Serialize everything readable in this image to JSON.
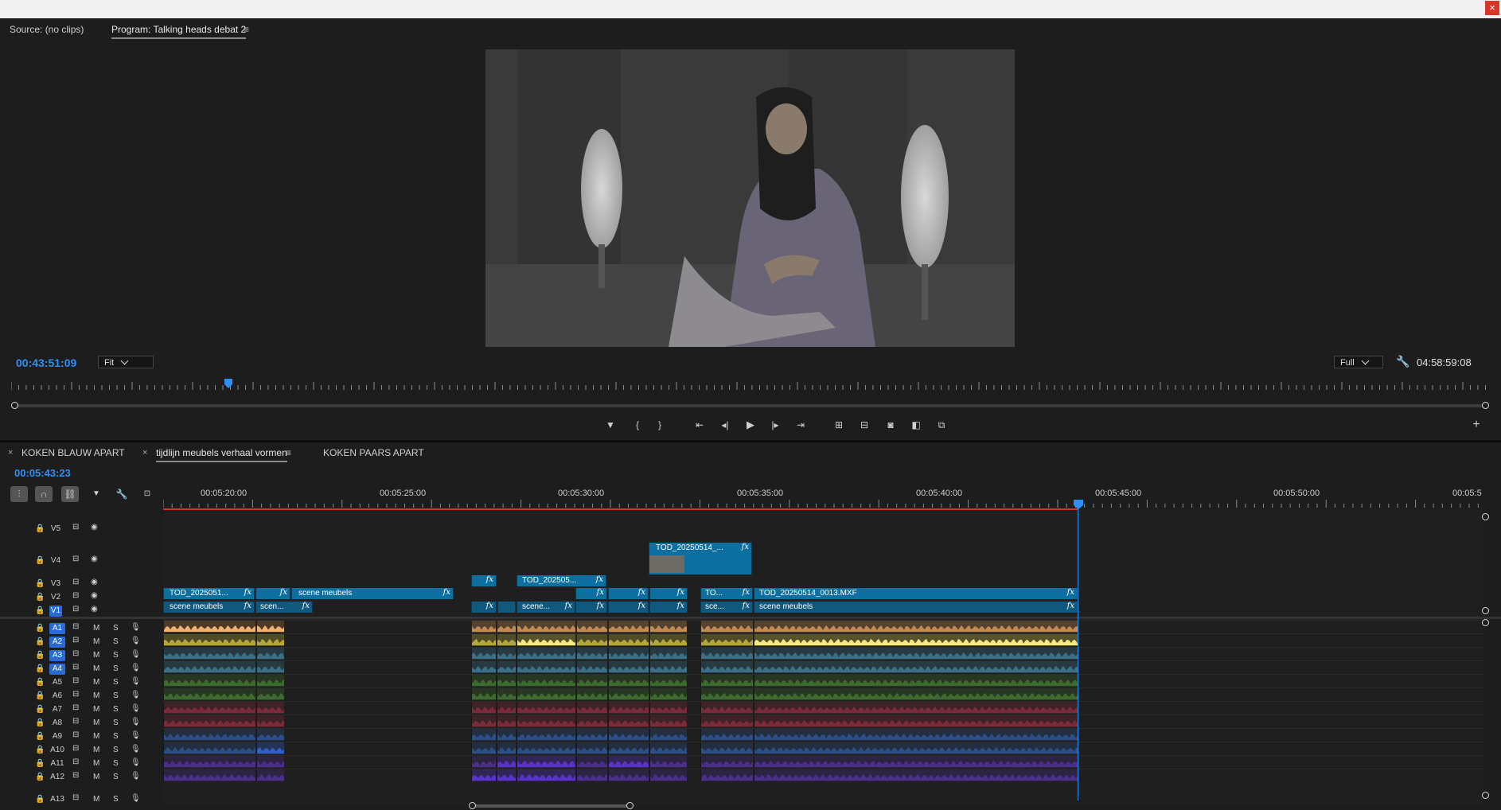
{
  "source_panel": {
    "source_tab": "Source: (no clips)",
    "program_tab": "Program: Talking heads debat 2",
    "menu_glyph": "≡"
  },
  "program_monitor": {
    "current_timecode": "00:43:51:09",
    "zoom_select": "Fit",
    "resolution_select": "Full",
    "duration_timecode": "04:58:59:08",
    "playhead_fraction": 0.147
  },
  "transport_icons": [
    "add-marker-icon",
    "mark-in-icon",
    "mark-out-icon",
    "go-to-in-icon",
    "step-back-icon",
    "play-icon",
    "step-forward-icon",
    "go-to-out-icon",
    "insert-icon",
    "overwrite-icon",
    "export-frame-icon",
    "comparison-view-icon",
    "multi-camera-icon",
    "add-button-icon"
  ],
  "sequence_tabs": [
    {
      "label": "KOKEN BLAUW APART",
      "closable": true,
      "active": false
    },
    {
      "label": "tijdlijn meubels verhaal vormen",
      "closable": true,
      "active": true
    },
    {
      "label": "KOKEN PAARS APART",
      "closable": false,
      "active": false
    }
  ],
  "timeline": {
    "current_timecode": "00:05:43:23",
    "ruler_labels": [
      "00:05:20:00",
      "00:05:25:00",
      "00:05:30:00",
      "00:05:35:00",
      "00:05:40:00",
      "00:05:45:00",
      "00:05:50:00",
      "00:05:5"
    ],
    "video_tracks": [
      {
        "name": "V5",
        "selected": false
      },
      {
        "name": "V4",
        "selected": false
      },
      {
        "name": "V3",
        "selected": false
      },
      {
        "name": "V2",
        "selected": false
      },
      {
        "name": "V1",
        "selected": true
      }
    ],
    "audio_tracks": [
      {
        "name": "A1",
        "selected": true,
        "color": "#c08a52"
      },
      {
        "name": "A2",
        "selected": true,
        "color": "#b3a83a"
      },
      {
        "name": "A3",
        "selected": true,
        "color": "#3a6f86"
      },
      {
        "name": "A4",
        "selected": true,
        "color": "#3a6f86"
      },
      {
        "name": "A5",
        "selected": false,
        "color": "#3d6a2e"
      },
      {
        "name": "A6",
        "selected": false,
        "color": "#3d6a2e"
      },
      {
        "name": "A7",
        "selected": false,
        "color": "#7a2a3a"
      },
      {
        "name": "A8",
        "selected": false,
        "color": "#7a2a3a"
      },
      {
        "name": "A9",
        "selected": false,
        "color": "#2d4d86"
      },
      {
        "name": "A10",
        "selected": false,
        "color": "#2d4d86"
      },
      {
        "name": "A11",
        "selected": false,
        "color": "#4b2d8a"
      },
      {
        "name": "A12",
        "selected": false,
        "color": "#4b2d8a"
      },
      {
        "name": "A13",
        "selected": false,
        "color": "#2d2d2d"
      }
    ],
    "track_toggles": {
      "mute": "M",
      "solo": "S"
    },
    "fx_label": "fx",
    "clips": {
      "v4_main": "TOD_20250514_...",
      "v3_main": "TOD_202505...",
      "v2": [
        "TOD_2025051...",
        "scene meubels",
        "TO...",
        "TOD_20250514_0013.MXF"
      ],
      "v1": [
        "scene meubels",
        "scen...",
        "scene...",
        "sce...",
        "scene meubels"
      ]
    }
  }
}
